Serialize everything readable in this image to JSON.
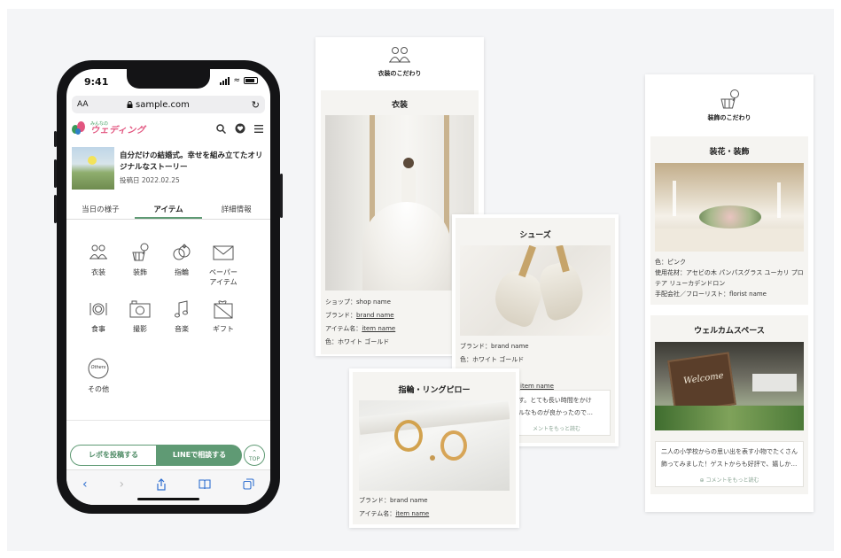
{
  "phone": {
    "status_time": "9:41",
    "url_aa": "AA",
    "url": "sample.com",
    "logo_small": "みんなの",
    "logo_big": "ウェディング",
    "article_title": "自分だけの結婚式。幸せを組み立てたオリジナルなストーリー",
    "article_date": "投稿日 2022.02.25",
    "tabs": [
      "当日の様子",
      "アイテム",
      "詳細情報"
    ],
    "items": [
      {
        "label": "衣装",
        "icon": "couple-icon"
      },
      {
        "label": "装飾",
        "icon": "decoration-icon"
      },
      {
        "label": "指輪",
        "icon": "rings-icon"
      },
      {
        "label": "ペーパー\nアイテム",
        "icon": "envelope-icon"
      },
      {
        "label": "食事",
        "icon": "dining-icon"
      },
      {
        "label": "撮影",
        "icon": "camera-icon"
      },
      {
        "label": "音楽",
        "icon": "music-note-icon"
      },
      {
        "label": "ギフト",
        "icon": "gift-icon"
      },
      {
        "label": "その他",
        "icon": "others-badge-icon"
      }
    ],
    "badge_text": "Others",
    "repo_button": "レポを投稿する",
    "line_button": "LINEで相談する",
    "top_button": "TOP"
  },
  "costume_card": {
    "section_title": "衣装のこだわり",
    "sub_title": "衣装",
    "meta": {
      "shop_label": "ショップ：",
      "shop_value": "shop name",
      "brand_label": "ブランド：",
      "brand_value": "brand name",
      "item_label": "アイテム名：",
      "item_value": "item name",
      "color_line": "色：ホワイト ゴールド"
    }
  },
  "shoes_card": {
    "sub_title": "シューズ",
    "brand_line": "ブランド：brand name",
    "color_line": "色：ホワイト ゴールド",
    "type_line": "タイプ：パンプス",
    "item_link": "item name",
    "comment_line1": "です。とても長い時間をかけ",
    "comment_line2": "プルなものが良かったので…",
    "more": "メントをもっと読む"
  },
  "ring_card": {
    "sub_title": "指輪・リングピロー",
    "brand_line": "ブランド：brand name",
    "item_label": "アイテム名：",
    "item_value": "item name"
  },
  "decor_card": {
    "section_title": "装飾のこだわり",
    "flower_title": "装花・装飾",
    "color_line": "色：ピンク",
    "flowers_line": "使用花材：アセビの木 パンパスグラス ユーカリ プロテア リューカデンドロン",
    "florist_line": "手配会社／フローリスト：florist name",
    "welcome_title": "ウェルカムスペース",
    "welcome_sign": "Welcome",
    "comment": "二人の小学校からの思い出を表す小物でたくさん飾ってみました！ゲストからも好評で、嬉しか…",
    "more": "コメントをもっと読む"
  },
  "colors": {
    "accent_green": "#5f9a74",
    "logo_pink": "#e2557f",
    "panel_bg": "#f4f5f7",
    "subcard_bg": "#f5f4f1"
  }
}
